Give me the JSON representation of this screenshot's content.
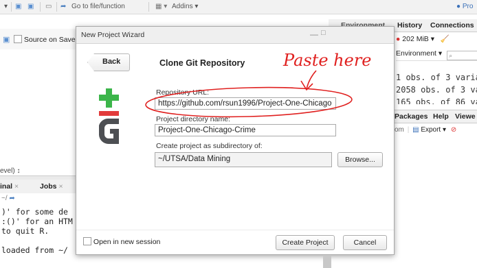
{
  "toolbar": {
    "goto_placeholder": "Go to file/function",
    "addins_label": "Addins",
    "project_label": "Pro"
  },
  "editor": {
    "source_on_save": "Source on Save"
  },
  "left_pane": {
    "level_label": "evel) ↕",
    "tab_terminal": "inal",
    "tab_jobs": "Jobs",
    "path_fragment": "~/"
  },
  "console": {
    "lines": [
      ")' for some de",
      ":()' for an HTM",
      "to quit R.",
      "",
      "loaded from ~/"
    ]
  },
  "right_pane": {
    "tabs": [
      "Environment",
      "History",
      "Connections"
    ],
    "memory": "202 MiB",
    "env_dropdown": "Environment",
    "objects": [
      "1 obs. of 3 varia",
      "2058 obs. of 3 va",
      "165 obs. of 86 va"
    ],
    "lower_tabs": [
      "Packages",
      "Help",
      "Viewe"
    ],
    "export_label": "Export",
    "zoom_fragment": "om"
  },
  "dialog": {
    "title": "New Project Wizard",
    "back_label": "Back",
    "heading": "Clone Git Repository",
    "repo_url_label": "Repository URL:",
    "repo_url_value": "https://github.com/rsun1996/Project-One-Chicago",
    "dir_name_label": "Project directory name:",
    "dir_name_value": "Project-One-Chicago-Crime",
    "subdir_label": "Create project as subdirectory of:",
    "subdir_value": "~/UTSA/Data Mining",
    "browse_label": "Browse...",
    "new_session_label": "Open in new session",
    "create_label": "Create Project",
    "cancel_label": "Cancel"
  },
  "annotation": {
    "text": "Paste here",
    "color": "#e0201f"
  },
  "colors": {
    "git_green": "#3bb54a",
    "git_red": "#e23b3b",
    "git_gray": "#4d4f53"
  }
}
